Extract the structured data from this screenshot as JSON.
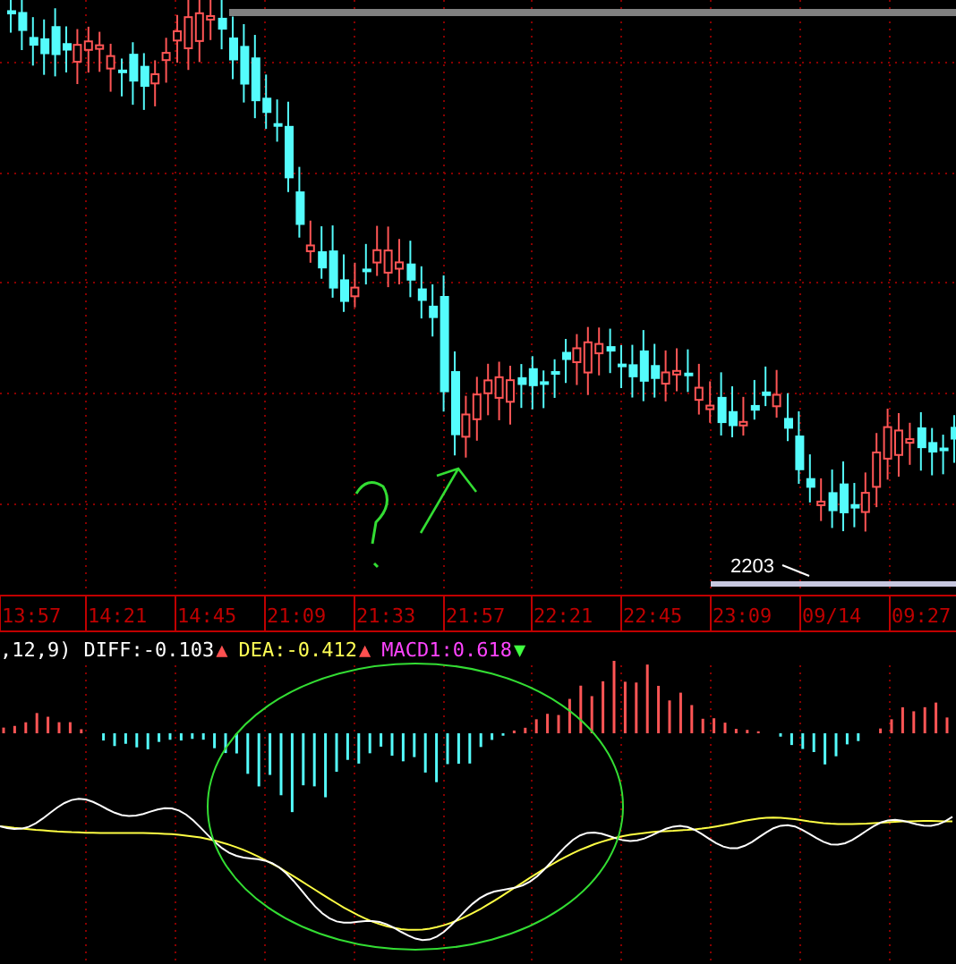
{
  "price_chart": {
    "low_label": "2203"
  },
  "time_axis": [
    "13:57",
    "14:21",
    "14:45",
    "21:09",
    "21:33",
    "21:57",
    "22:21",
    "22:45",
    "23:09",
    "09/14",
    "09:27"
  ],
  "macd_legend": {
    "params": ",12,9)",
    "items": [
      {
        "kind": "diff",
        "text": "DIFF:-0.103",
        "arrow": {
          "glyph": "▲",
          "color": "#ff5050"
        }
      },
      {
        "kind": "dea",
        "text": "DEA:-0.412",
        "arrow": {
          "glyph": "▲",
          "color": "#ff5050"
        }
      },
      {
        "kind": "macd",
        "text": "MACD1:0.618",
        "arrow": {
          "glyph": "▼",
          "color": "#40ff40"
        }
      }
    ]
  }
}
